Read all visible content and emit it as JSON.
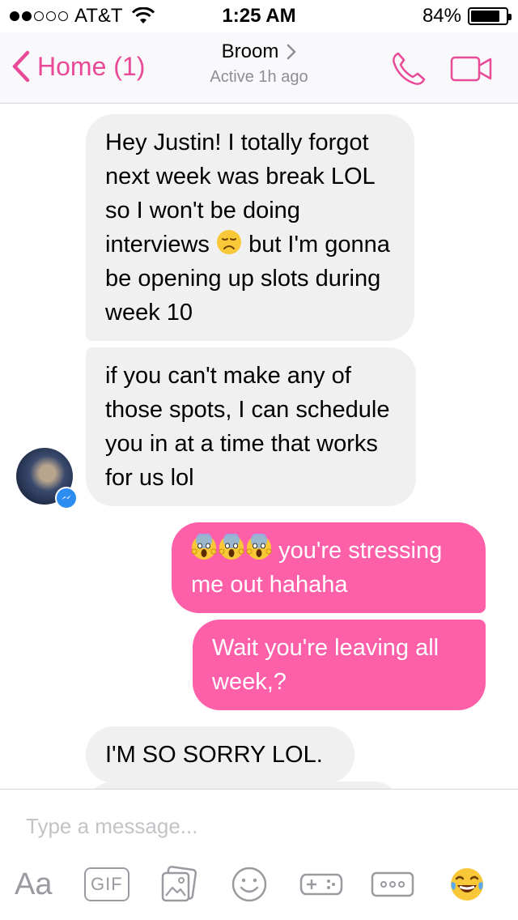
{
  "status_bar": {
    "carrier": "AT&T",
    "signal_bars": 2,
    "time": "1:25 AM",
    "battery": "84%",
    "battery_level": 0.84
  },
  "nav": {
    "back_label": "Home (1)",
    "contact_name": "Broom",
    "status": "Active 1h ago",
    "call_icon": "phone-icon",
    "video_icon": "video-camera-icon"
  },
  "messages": [
    {
      "from": "them",
      "text_before": "Hey Justin! I totally forgot next week was break LOL so I won't be doing interviews",
      "emoji": "disappointed-face",
      "text_after": " but I'm gonna be opening up slots during week 10"
    },
    {
      "from": "them",
      "text": "if you can't make any of those spots, I can schedule you in at a time that works for us lol"
    },
    {
      "from": "me",
      "emoji": "screaming-face x3",
      "text": " you're stressing me out hahaha"
    },
    {
      "from": "me",
      "text": "Wait you're leaving all week,?"
    },
    {
      "from": "them",
      "text": "I'M SO SORRY LOL."
    }
  ],
  "composer": {
    "placeholder": "Type a message...",
    "tools": {
      "text_label": "Aa",
      "gif_label": "GIF",
      "photo_icon": "photo-gallery-icon",
      "sticker_icon": "smiley-icon",
      "game_icon": "gamepad-icon",
      "more_icon": "more-icon",
      "emoji_icon": "laughing-emoji-icon"
    }
  },
  "colors": {
    "accent": "#e84a97",
    "outgoing_bubble": "#fd5fa8",
    "incoming_bubble": "#f0f0f0",
    "messenger_badge": "#2d8cf0"
  }
}
